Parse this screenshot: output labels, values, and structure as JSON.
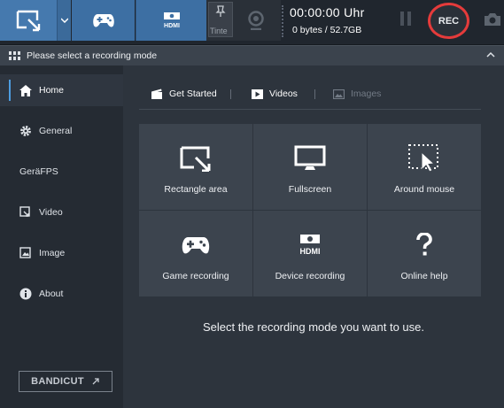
{
  "toolbar": {
    "webcam_overlay_label": "Tinte",
    "timer": "00:00:00 Uhr",
    "size": "0 bytes / 52.7GB",
    "rec_label": "REC"
  },
  "modebar": {
    "title": "Please select a recording mode"
  },
  "sidebar": {
    "items": [
      {
        "label": "Home",
        "icon": "home-icon"
      },
      {
        "label": "General",
        "icon": "gear-icon"
      },
      {
        "label": "GeräFPS",
        "icon": ""
      },
      {
        "label": "Video",
        "icon": "video-icon"
      },
      {
        "label": "Image",
        "icon": "image-icon"
      },
      {
        "label": "About",
        "icon": "info-icon"
      }
    ],
    "bandicut_label": "BANDICUT"
  },
  "tabs": [
    {
      "label": "Get Started",
      "icon": "clapperboard-icon"
    },
    {
      "label": "Videos",
      "icon": "play-icon"
    },
    {
      "label": "Images",
      "icon": "image-icon"
    }
  ],
  "tiles": [
    {
      "label": "Rectangle area",
      "icon": "rectangle-area-icon"
    },
    {
      "label": "Fullscreen",
      "icon": "monitor-icon"
    },
    {
      "label": "Around mouse",
      "icon": "around-mouse-icon"
    },
    {
      "label": "Game recording",
      "icon": "gamepad-icon"
    },
    {
      "label": "Device recording",
      "icon": "hdmi-icon"
    },
    {
      "label": "Online help",
      "icon": "question-icon"
    }
  ],
  "hint": "Select the recording mode you want to use.",
  "colors": {
    "accent_blue": "#4579ae",
    "rec_red": "#e53b3b",
    "active_indicator": "#4d9de0"
  }
}
